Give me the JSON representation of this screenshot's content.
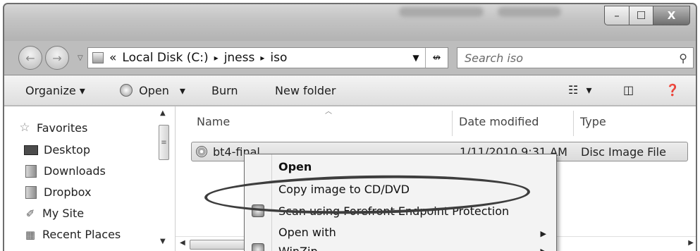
{
  "window": {
    "controls": {
      "minimize": "–",
      "maximize": "☐",
      "close": "X"
    }
  },
  "nav": {
    "back_icon": "←",
    "forward_icon": "→",
    "address": {
      "prefix": "«",
      "segments": [
        "Local Disk (C:)",
        "jness",
        "iso"
      ],
      "separator": "▸"
    },
    "search": {
      "placeholder": "Search iso"
    }
  },
  "toolbar": {
    "organize": "Organize",
    "open": "Open",
    "burn": "Burn",
    "new_folder": "New folder",
    "dropdown_glyph": "▾"
  },
  "sidebar": {
    "favorites": "Favorites",
    "items": [
      "Desktop",
      "Downloads",
      "Dropbox",
      "My Site",
      "Recent Places"
    ]
  },
  "columns": {
    "name": "Name",
    "date_modified": "Date modified",
    "type": "Type"
  },
  "files": [
    {
      "name": "bt4-final",
      "date_modified": "1/11/2010 9:31 AM",
      "type": "Disc Image File"
    }
  ],
  "context_menu": {
    "items": [
      {
        "label": "Open",
        "bold": true
      },
      {
        "label": "Copy image to CD/DVD",
        "highlighted_by_oval": true
      },
      {
        "label": "Scan using Forefront Endpoint Protection"
      },
      {
        "label": "Open with",
        "submenu": true
      },
      {
        "label": "WinZip",
        "submenu": true
      }
    ]
  },
  "icons": {
    "titlebar": [
      "minimize-icon",
      "maximize-icon",
      "close-icon"
    ],
    "nav": [
      "back-icon",
      "forward-icon",
      "folder-icon",
      "refresh-icon",
      "search-icon"
    ],
    "toolbar": [
      "open-program-icon",
      "views-icon",
      "preview-pane-icon",
      "help-icon"
    ],
    "sidebar": [
      "favorites-star-icon",
      "desktop-icon",
      "downloads-folder-icon",
      "dropbox-folder-icon",
      "my-site-icon",
      "recent-places-icon"
    ],
    "file": [
      "disc-image-icon"
    ],
    "menu": [
      "shield-icon",
      "winzip-icon"
    ]
  }
}
